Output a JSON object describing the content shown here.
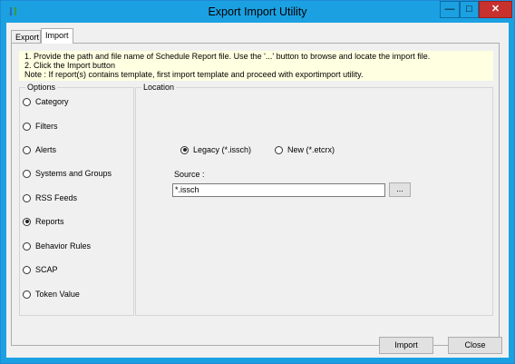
{
  "window": {
    "title": "Export Import Utility",
    "minimize_glyph": "—",
    "maximize_glyph": "□",
    "close_glyph": "✕"
  },
  "tabs": [
    {
      "label": "Export",
      "selected": false
    },
    {
      "label": "Import",
      "selected": true
    }
  ],
  "info": {
    "line1": "1. Provide the path and file name of Schedule Report file. Use the '...' button to browse and locate the import file.",
    "line2": "2. Click the Import button",
    "line3": "Note : If report(s) contains template, first import template and proceed with exportimport utility."
  },
  "options": {
    "legend": "Options",
    "items": [
      {
        "label": "Category",
        "selected": false
      },
      {
        "label": "Filters",
        "selected": false
      },
      {
        "label": "Alerts",
        "selected": false
      },
      {
        "label": "Systems and Groups",
        "selected": false
      },
      {
        "label": "RSS Feeds",
        "selected": false
      },
      {
        "label": "Reports",
        "selected": true
      },
      {
        "label": "Behavior Rules",
        "selected": false
      },
      {
        "label": "SCAP",
        "selected": false
      },
      {
        "label": "Token Value",
        "selected": false
      }
    ]
  },
  "location": {
    "legend": "Location",
    "format_options": [
      {
        "label": "Legacy (*.issch)",
        "selected": true
      },
      {
        "label": "New (*.etcrx)",
        "selected": false
      }
    ],
    "source_label": "Source :",
    "source_value": "*.issch",
    "browse_label": "..."
  },
  "footer": {
    "import_label": "Import",
    "close_label": "Close"
  },
  "colors": {
    "titlebar": "#1ba1e2",
    "close_button": "#c7312e",
    "info_background": "#ffffe1",
    "client_background": "#f0f0f0"
  }
}
